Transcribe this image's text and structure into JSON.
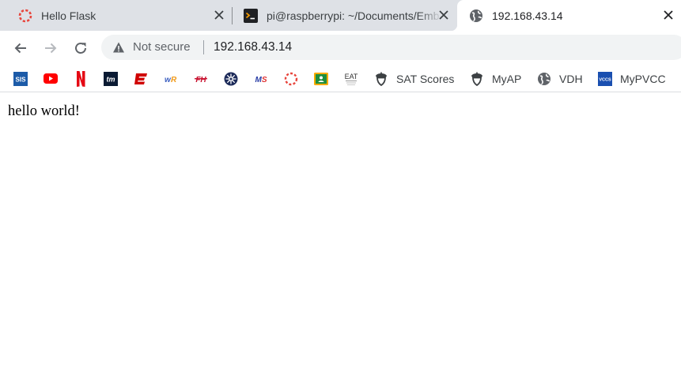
{
  "tabs": [
    {
      "title": "Hello Flask",
      "favicon": "red-ring-icon",
      "active": false
    },
    {
      "title": "pi@raspberrypi: ~/Documents/Emb",
      "favicon": "terminal-icon",
      "active": false
    },
    {
      "title": "192.168.43.14",
      "favicon": "globe-icon",
      "active": true
    }
  ],
  "address_bar": {
    "security_label": "Not secure",
    "url": "192.168.43.14"
  },
  "bookmarks": [
    {
      "label": "",
      "icon": "sis-icon"
    },
    {
      "label": "",
      "icon": "youtube-icon"
    },
    {
      "label": "",
      "icon": "netflix-icon"
    },
    {
      "label": "",
      "icon": "tm-icon"
    },
    {
      "label": "",
      "icon": "espn-icon"
    },
    {
      "label": "",
      "icon": "wr-icon"
    },
    {
      "label": "",
      "icon": "fh-icon"
    },
    {
      "label": "",
      "icon": "kubernetes-icon"
    },
    {
      "label": "",
      "icon": "ms-icon"
    },
    {
      "label": "",
      "icon": "red-ring-icon"
    },
    {
      "label": "",
      "icon": "classroom-icon"
    },
    {
      "label": "",
      "icon": "eat-icon"
    },
    {
      "label": "SAT Scores",
      "icon": "acorn-icon"
    },
    {
      "label": "MyAP",
      "icon": "acorn-icon"
    },
    {
      "label": "VDH",
      "icon": "globe-icon"
    },
    {
      "label": "MyPVCC",
      "icon": "vccs-icon"
    }
  ],
  "page": {
    "body_text": "hello world!"
  },
  "colors": {
    "tabstrip_bg": "#dee1e6",
    "omnibox_bg": "#f1f3f4",
    "youtube_red": "#ff0000",
    "netflix_red": "#e50914",
    "sis_blue": "#1c5ba8",
    "classroom_green": "#1e8e3e"
  }
}
